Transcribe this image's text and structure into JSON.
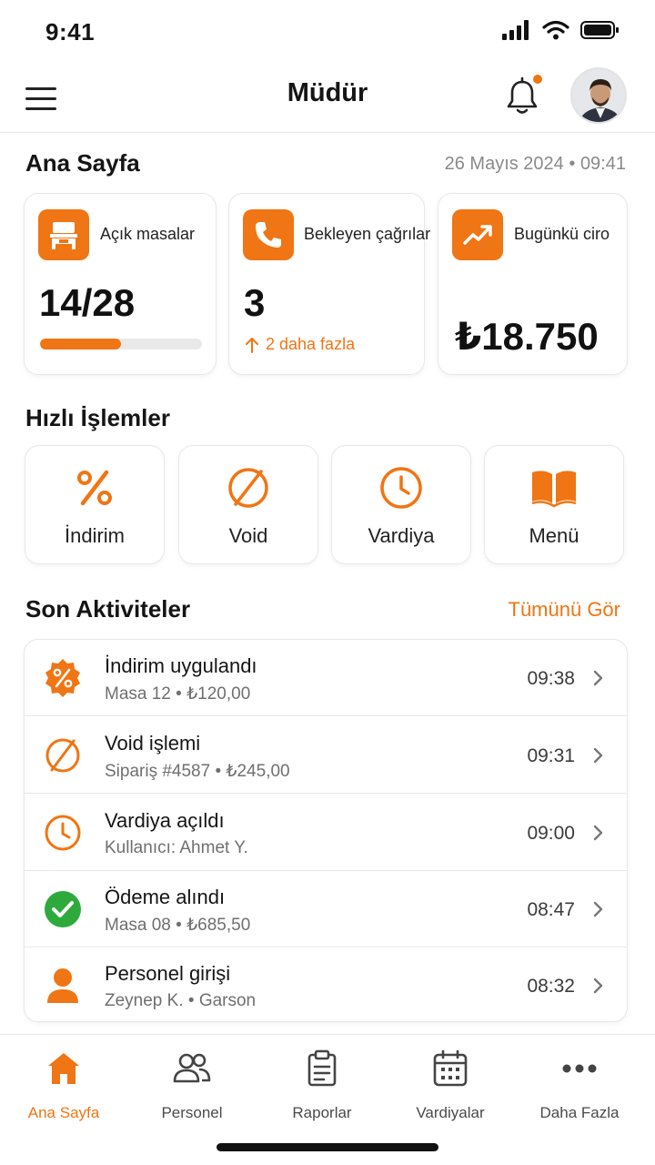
{
  "status": {
    "time": "9:41"
  },
  "header": {
    "title": "Müdür"
  },
  "overview": {
    "title": "Ana Sayfa",
    "date": "26 Mayıs 2024",
    "time": "09:41"
  },
  "stats": {
    "open_tables": {
      "label": "Açık masalar",
      "value": "14/28",
      "progress_fraction": 0.5
    },
    "pending_calls": {
      "label": "Bekleyen çağrılar",
      "value": "3",
      "trend": "2 daha fazla"
    },
    "revenue": {
      "label": "Bugünkü ciro",
      "value": "₺18.750"
    }
  },
  "quick_actions": {
    "title": "Hızlı İşlemler",
    "items": [
      {
        "label": "İndirim",
        "icon": "percent-icon"
      },
      {
        "label": "Void",
        "icon": "void-icon"
      },
      {
        "label": "Vardiya",
        "icon": "clock-icon"
      },
      {
        "label": "Menü",
        "icon": "book-icon"
      }
    ]
  },
  "activities": {
    "title": "Son Aktiviteler",
    "see_all": "Tümünü Gör",
    "items": [
      {
        "title": "İndirim uygulandı",
        "subtitle": "Masa 12 • ₺120,00",
        "time": "09:38",
        "icon": "discount-badge-icon"
      },
      {
        "title": "Void işlemi",
        "subtitle": "Sipariş #4587 • ₺245,00",
        "time": "09:31",
        "icon": "void-icon"
      },
      {
        "title": "Vardiya açıldı",
        "subtitle": "Kullanıcı: Ahmet Y.",
        "time": "09:00",
        "icon": "clock-icon"
      },
      {
        "title": "Ödeme alındı",
        "subtitle": "Masa 08 • ₺685,50",
        "time": "08:47",
        "icon": "check-circle-icon"
      },
      {
        "title": "Personel girişi",
        "subtitle": "Zeynep K. • Garson",
        "time": "08:32",
        "icon": "person-icon"
      }
    ]
  },
  "tabs": [
    {
      "label": "Ana Sayfa",
      "icon": "home-icon",
      "active": true
    },
    {
      "label": "Personel",
      "icon": "people-icon",
      "active": false
    },
    {
      "label": "Raporlar",
      "icon": "clipboard-icon",
      "active": false
    },
    {
      "label": "Vardiyalar",
      "icon": "calendar-icon",
      "active": false
    },
    {
      "label": "Daha Fazla",
      "icon": "more-icon",
      "active": false
    }
  ],
  "colors": {
    "accent": "#f07514",
    "success": "#2eaa3c",
    "text": "#151515",
    "muted": "#8a8a8a"
  }
}
